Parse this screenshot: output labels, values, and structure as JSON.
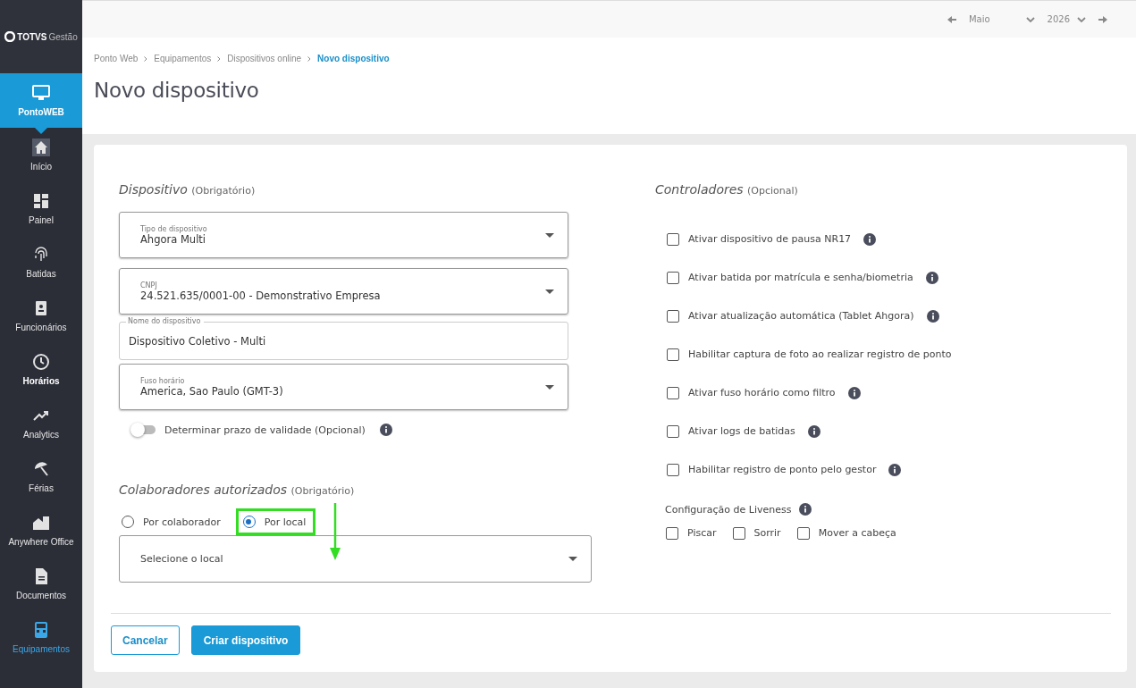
{
  "sidebar": {
    "logo": {
      "brand": "TOTVS",
      "product": "Gestão"
    },
    "items": [
      {
        "label": "PontoWEB",
        "selected": true,
        "emphasized": false,
        "current": false
      },
      {
        "label": "Início",
        "selected": false,
        "emphasized": false,
        "current": false
      },
      {
        "label": "Painel",
        "selected": false,
        "emphasized": false,
        "current": false
      },
      {
        "label": "Batidas",
        "selected": false,
        "emphasized": false,
        "current": false
      },
      {
        "label": "Funcionários",
        "selected": false,
        "emphasized": false,
        "current": false
      },
      {
        "label": "Horários",
        "selected": false,
        "emphasized": true,
        "current": false
      },
      {
        "label": "Analytics",
        "selected": false,
        "emphasized": false,
        "current": false
      },
      {
        "label": "Férias",
        "selected": false,
        "emphasized": false,
        "current": false
      },
      {
        "label": "Anywhere Office",
        "selected": false,
        "emphasized": false,
        "current": false
      },
      {
        "label": "Documentos",
        "selected": false,
        "emphasized": false,
        "current": false
      },
      {
        "label": "Equipamentos",
        "selected": false,
        "emphasized": false,
        "current": true
      }
    ]
  },
  "period": {
    "month": "Maio",
    "year": "2026"
  },
  "breadcrumb": [
    {
      "label": "Ponto Web",
      "current": false
    },
    {
      "label": "Equipamentos",
      "current": false
    },
    {
      "label": "Dispositivos online",
      "current": false
    },
    {
      "label": "Novo dispositivo",
      "current": true
    }
  ],
  "page_title": "Novo dispositivo",
  "device_section": {
    "title": "Dispositivo",
    "note": "(Obrigatório)",
    "fields": [
      {
        "kind": "select",
        "label": "Tipo de dispositivo",
        "value": "Ahgora Multi"
      },
      {
        "kind": "select",
        "label": "CNPJ",
        "value": "24.521.635/0001-00 - Demonstrativo Empresa"
      },
      {
        "kind": "text",
        "label": "Nome do dispositivo",
        "value": "Dispositivo Coletivo - Multi"
      },
      {
        "kind": "select",
        "label": "Fuso horário",
        "value": "America, Sao Paulo (GMT-3)"
      }
    ],
    "validity_toggle": {
      "label": "Determinar prazo de validade (Opcional)",
      "on": false,
      "info": true
    }
  },
  "collaborators_section": {
    "title": "Colaboradores autorizados",
    "note": "(Obrigatório)",
    "options": [
      {
        "label": "Por colaborador",
        "selected": false,
        "highlighted": false
      },
      {
        "label": "Por local",
        "selected": true,
        "highlighted": true
      }
    ],
    "location_select": {
      "placeholder": "Selecione o local"
    }
  },
  "controllers_section": {
    "title": "Controladores",
    "note": "(Opcional)",
    "options": [
      {
        "label": "Ativar dispositivo de pausa NR17",
        "checked": false,
        "info": true
      },
      {
        "label": "Ativar batida por matrícula e senha/biometria",
        "checked": false,
        "info": true
      },
      {
        "label": "Ativar atualização automática (Tablet Ahgora)",
        "checked": false,
        "info": true
      },
      {
        "label": "Habilitar captura de foto ao realizar registro de ponto",
        "checked": false,
        "info": false
      },
      {
        "label": "Ativar fuso horário como filtro",
        "checked": false,
        "info": true
      },
      {
        "label": "Ativar logs de batidas",
        "checked": false,
        "info": true
      },
      {
        "label": "Habilitar registro de ponto pelo gestor",
        "checked": false,
        "info": true
      }
    ],
    "liveness": {
      "label": "Configuração de Liveness",
      "info": true,
      "options": [
        {
          "label": "Piscar",
          "checked": false
        },
        {
          "label": "Sorrir",
          "checked": false
        },
        {
          "label": "Mover a cabeça",
          "checked": false
        }
      ]
    }
  },
  "buttons": [
    {
      "label": "Cancelar",
      "kind": "secondary"
    },
    {
      "label": "Criar dispositivo",
      "kind": "primary"
    }
  ]
}
